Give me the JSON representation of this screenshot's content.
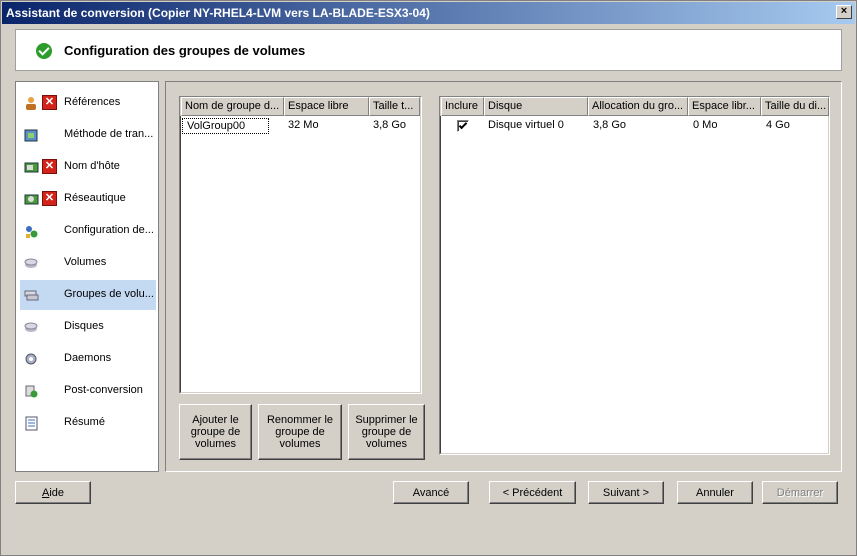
{
  "window": {
    "title": "Assistant de conversion (Copier NY-RHEL4-LVM vers LA-BLADE-ESX3-04)",
    "close_label": "×"
  },
  "header": {
    "title": "Configuration des groupes de volumes",
    "icon": "green-check-icon"
  },
  "sidebar": {
    "items": [
      {
        "label": "Références",
        "icon": "references-icon",
        "error": true
      },
      {
        "label": "Méthode de tran...",
        "icon": "transfer-method-icon",
        "error": false
      },
      {
        "label": "Nom d'hôte",
        "icon": "host-name-icon",
        "error": true
      },
      {
        "label": "Réseautique",
        "icon": "network-icon",
        "error": true
      },
      {
        "label": "Configuration de...",
        "icon": "configuration-icon",
        "error": false
      },
      {
        "label": "Volumes",
        "icon": "volumes-icon",
        "error": false
      },
      {
        "label": "Groupes de volu...",
        "icon": "volume-groups-icon",
        "error": false,
        "selected": true
      },
      {
        "label": "Disques",
        "icon": "disks-icon",
        "error": false
      },
      {
        "label": "Daemons",
        "icon": "daemons-icon",
        "error": false
      },
      {
        "label": "Post-conversion",
        "icon": "post-conversion-icon",
        "error": false
      },
      {
        "label": "Résumé",
        "icon": "summary-icon",
        "error": false
      }
    ]
  },
  "volume_groups_table": {
    "columns": [
      "Nom de groupe d...",
      "Espace libre",
      "Taille t..."
    ],
    "rows": [
      {
        "name": "VolGroup00",
        "free": "32 Mo",
        "size": "3,8 Go"
      }
    ]
  },
  "vg_buttons": {
    "add": "Ajouter le groupe de volumes",
    "rename": "Renommer le groupe de volumes",
    "delete": "Supprimer le groupe de volumes"
  },
  "disks_table": {
    "columns": [
      "Inclure",
      "Disque",
      "Allocation du gro...",
      "Espace libr...",
      "Taille du di..."
    ],
    "rows": [
      {
        "include": true,
        "disk": "Disque virtuel 0",
        "allocation": "3,8 Go",
        "free": "0 Mo",
        "size": "4 Go"
      }
    ]
  },
  "footer": {
    "help": "Aide",
    "advanced": "Avancé",
    "previous": "< Précédent",
    "next": "Suivant >",
    "cancel": "Annuler",
    "start": "Démarrer"
  },
  "colors": {
    "titlebar_start": "#0a246a",
    "titlebar_end": "#a6caf0",
    "selected_nav": "#c4d9f2",
    "error_red": "#d3241c",
    "check_green": "#2d9c2d"
  }
}
